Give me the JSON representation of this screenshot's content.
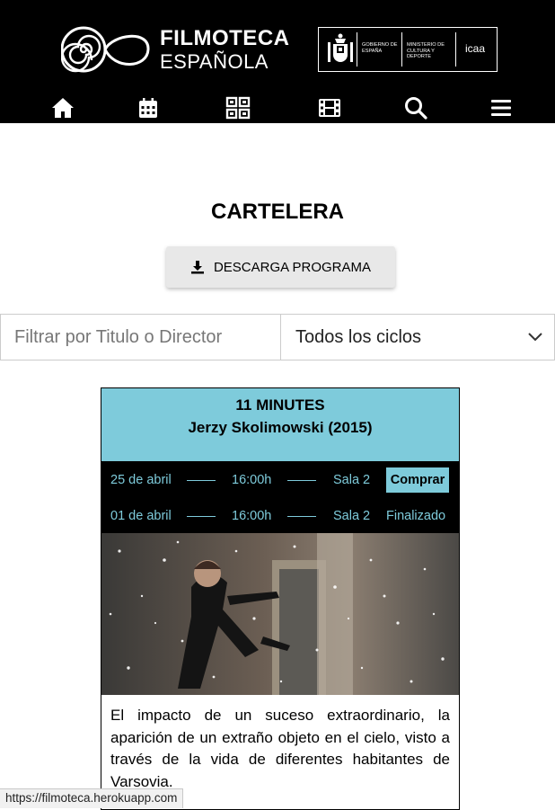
{
  "header": {
    "brand_top": "FILMOTECA",
    "brand_bottom": "ESPAÑOLA",
    "gov_label": "Gobierno de España",
    "ministry_label": "Ministerio de Cultura y Deporte",
    "icaa_label": "icaa",
    "nav_icons": [
      "home-icon",
      "calendar-icon",
      "film-grid-icon",
      "film-strip-icon",
      "search-icon",
      "menu-icon"
    ]
  },
  "page": {
    "title": "CARTELERA",
    "download_label": "DESCARGA PROGRAMA"
  },
  "filters": {
    "search_placeholder": "Filtrar por Titulo o Director",
    "search_value": "",
    "cycle_selected": "Todos los ciclos"
  },
  "film": {
    "title": "11 MINUTES",
    "director_year": "Jerzy Skolimowski (2015)",
    "sessions": [
      {
        "date": "25 de abril",
        "time": "16:00h",
        "room": "Sala 2",
        "action": "Comprar"
      },
      {
        "date": "01 de abril",
        "time": "16:00h",
        "room": "Sala 2",
        "action": "Finalizado"
      }
    ],
    "synopsis": "El impacto de un suceso extraordinario, la aparición de un extraño objeto en el cielo, visto a través de la vida de diferentes habitantes de Varsovia."
  },
  "colors": {
    "accent": "#7ecbdb",
    "header_bg": "#000000"
  },
  "statusbar": {
    "url": "https://filmoteca.herokuapp.com"
  }
}
